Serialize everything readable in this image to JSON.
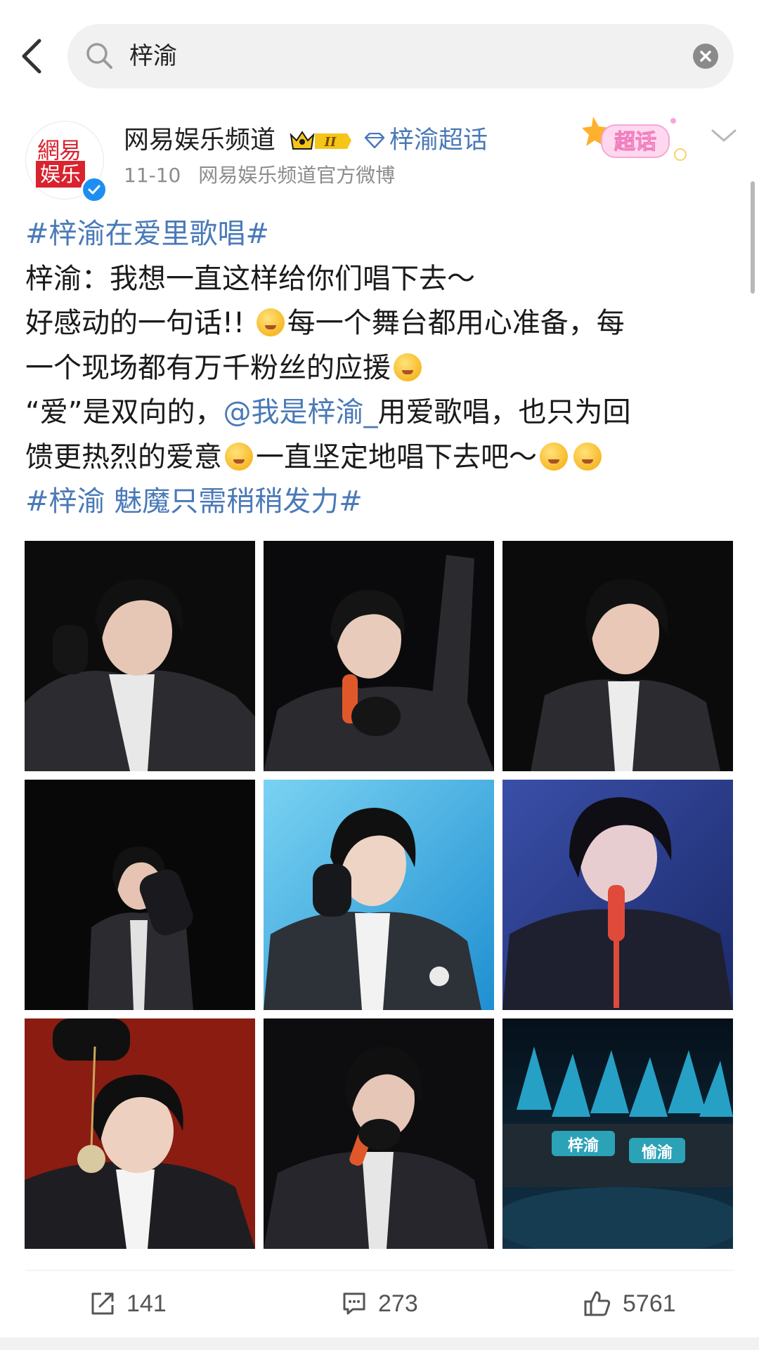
{
  "search": {
    "query": "梓渝"
  },
  "post": {
    "author": "网易娱乐频道",
    "avatar_logo_top": "網易",
    "avatar_logo_bottom": "娱乐",
    "level_badge": "II",
    "supertopic_link": "梓渝超话",
    "date": "11-10",
    "source": "网易娱乐频道官方微博",
    "supertopic_badge": "超话",
    "text": {
      "l1": "#梓渝在爱里歌唱#",
      "l2": "梓渝：我想一直这样给你们唱下去～",
      "l3a": "好感动的一句话!! ",
      "l3b": "每一个舞台都用心准备，每",
      "l4": "一个现场都有万千粉丝的应援",
      "l5a": "“爱”是双向的，",
      "l5b": "@我是梓渝_",
      "l5c": "用爱歌唱，也只为回",
      "l6a": "馈更热烈的爱意",
      "l6b": "一直坚定地唱下去吧～",
      "l7": "#梓渝 魅魔只需稍稍发力#"
    },
    "photos": [
      {
        "bg": "#0c0c0c"
      },
      {
        "bg": "#0a0a0c"
      },
      {
        "bg": "#0b0b0b"
      },
      {
        "bg": "#080808"
      },
      {
        "bg": "#3fb5e6"
      },
      {
        "bg": "#2a3f8a"
      },
      {
        "bg": "#8a1c12"
      },
      {
        "bg": "#0d0d10"
      },
      {
        "bg": "#0b1e2e"
      }
    ],
    "photo_texts": {
      "sign_a": "梓渝",
      "sign_b": "愉渝"
    },
    "stats": {
      "reposts": "141",
      "comments": "273",
      "likes": "5761"
    }
  },
  "icons": {
    "back": "chevron-left-icon",
    "search": "search-icon",
    "clear": "close-circle-icon",
    "repost": "repost-icon",
    "comment": "comment-icon",
    "like": "thumbs-up-icon"
  },
  "colors": {
    "link": "#4a79b8",
    "red": "#d9232f",
    "verified": "#1d8ff2"
  }
}
